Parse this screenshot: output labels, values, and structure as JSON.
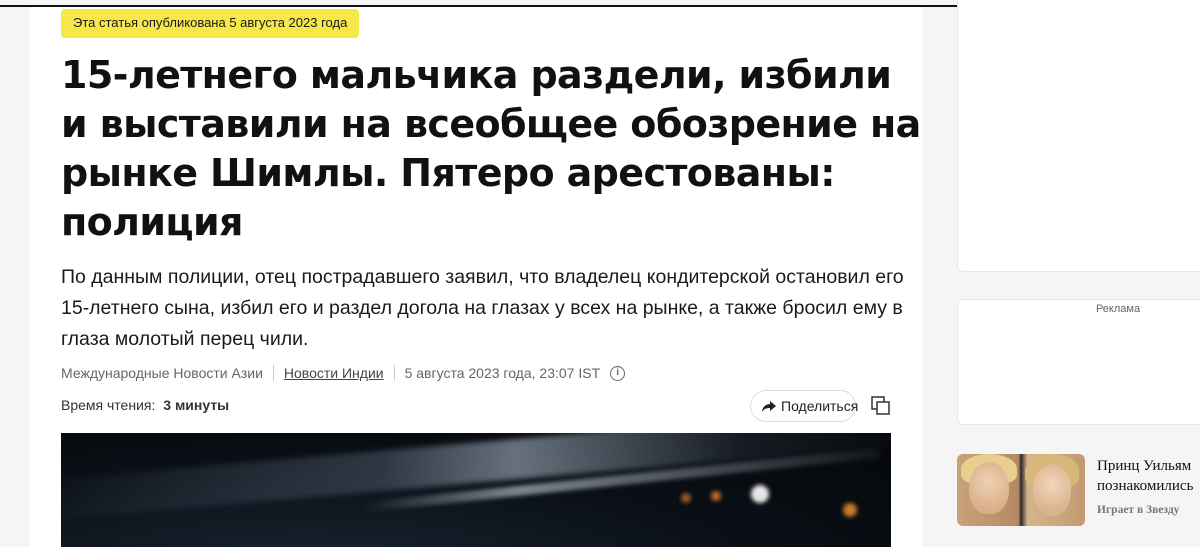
{
  "article": {
    "published_badge": "Эта статья опубликована 5 августа 2023 года",
    "headline": "15-летнего мальчика раздели, избили и выставили на всеобщее обозрение на рынке Шимлы. Пятеро арестованы: полиция",
    "lede": "По данным полиции, отец пострадавшего заявил, что владелец кондитерской остановил его 15-летнего сына, избил его и раздел догола на глазах у всех на рынке, а также бросил ему в глаза молотый перец чили.",
    "meta": {
      "section": "Международные Новости Азии",
      "category_link": "Новости Индии",
      "datetime": "5 августа 2023 года, 23:07 IST",
      "info_icon": "info-icon"
    },
    "reading_time_label": "Время чтения:",
    "reading_time_value": "3 минуты",
    "share_label": "Поделиться",
    "share_icon": "share-arrow-icon",
    "copy_icon": "copy-icon"
  },
  "sidebar": {
    "ad_label": "Реклама",
    "promo": {
      "title_line1": "Принц Уильям",
      "title_line2": "познакомились",
      "source": "Играет в Звезду"
    }
  },
  "colors": {
    "badge": "#f7e74a",
    "background": "#f5f5f5",
    "card": "#ffffff"
  }
}
